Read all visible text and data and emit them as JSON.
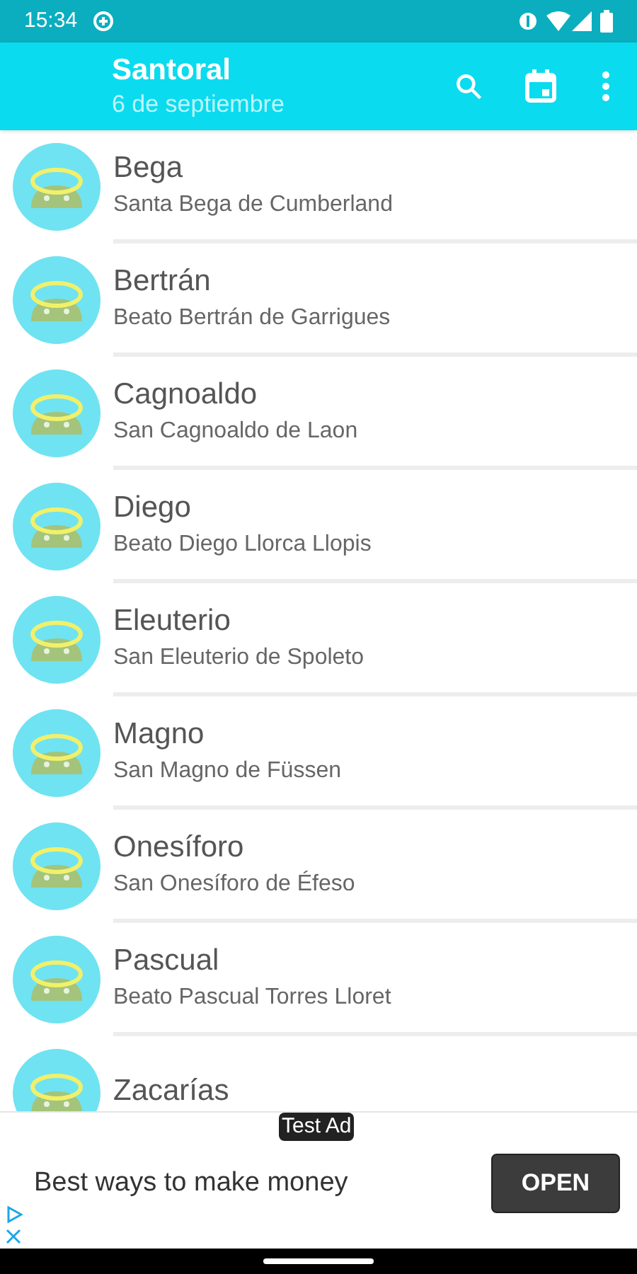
{
  "status_bar": {
    "time": "15:34"
  },
  "app_bar": {
    "title": "Santoral",
    "subtitle": "6 de septiembre"
  },
  "saints": [
    {
      "name": "Bega",
      "full_name": "Santa Bega de Cumberland"
    },
    {
      "name": "Bertrán",
      "full_name": "Beato Bertrán de Garrigues"
    },
    {
      "name": "Cagnoaldo",
      "full_name": "San Cagnoaldo de Laon"
    },
    {
      "name": "Diego",
      "full_name": "Beato Diego Llorca Llopis"
    },
    {
      "name": "Eleuterio",
      "full_name": "San Eleuterio de Spoleto"
    },
    {
      "name": "Magno",
      "full_name": "San Magno de Füssen"
    },
    {
      "name": "Onesíforo",
      "full_name": "San Onesíforo de Éfeso"
    },
    {
      "name": "Pascual",
      "full_name": "Beato Pascual Torres Lloret"
    },
    {
      "name": "Zacarías"
    }
  ],
  "ad": {
    "badge": "Test Ad",
    "headline": "Best ways to make money",
    "button": "OPEN"
  }
}
